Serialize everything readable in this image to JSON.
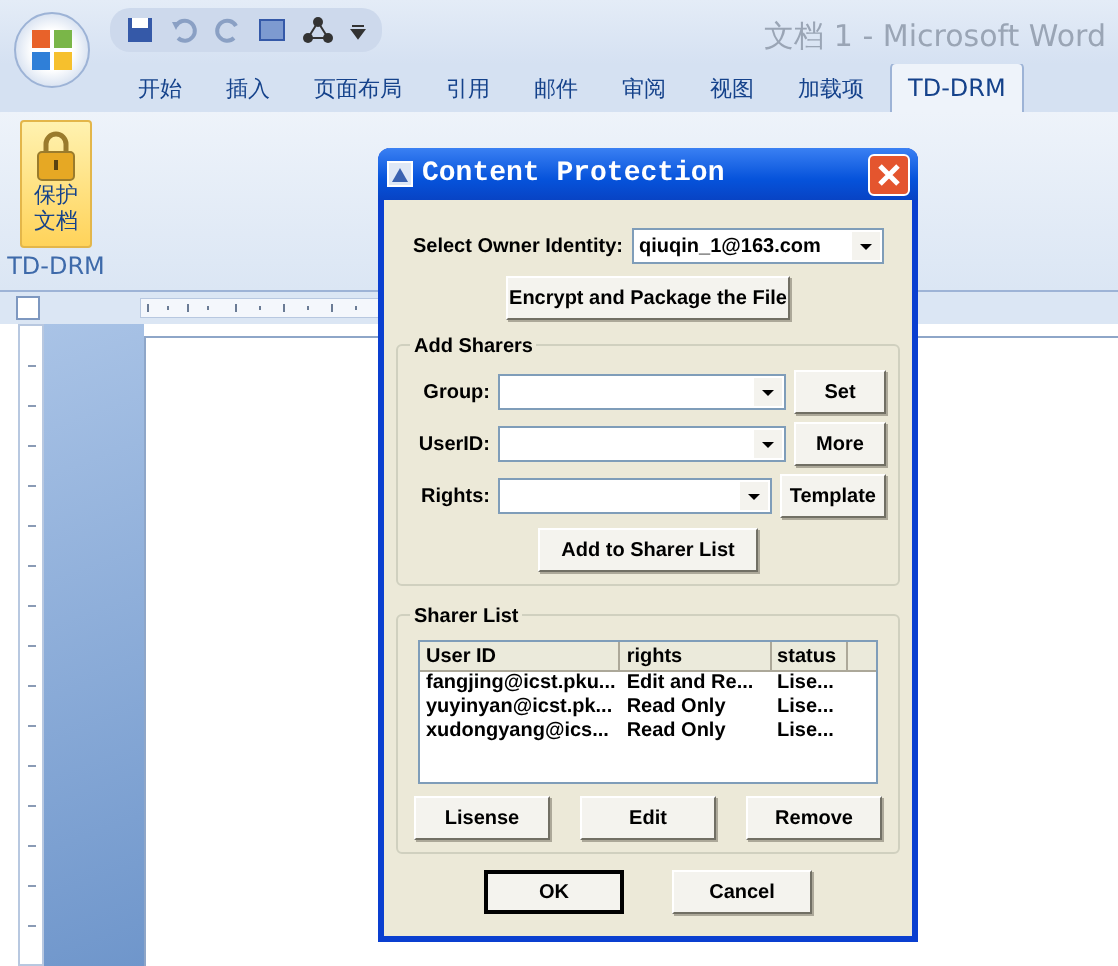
{
  "window": {
    "title": "文档 1 - Microsoft Word"
  },
  "ribbon_tabs": [
    {
      "label": "开始",
      "selected": false
    },
    {
      "label": "插入",
      "selected": false
    },
    {
      "label": "页面布局",
      "selected": false
    },
    {
      "label": "引用",
      "selected": false
    },
    {
      "label": "邮件",
      "selected": false
    },
    {
      "label": "审阅",
      "selected": false
    },
    {
      "label": "视图",
      "selected": false
    },
    {
      "label": "加载项",
      "selected": false
    },
    {
      "label": "TD-DRM",
      "selected": true
    }
  ],
  "ribbon": {
    "protect_button": [
      "保护",
      "文档"
    ],
    "group_label": "TD-DRM"
  },
  "dialog": {
    "title": "Content Protection",
    "owner_label": "Select Owner Identity:",
    "owner_value": "qiuqin_1@163.com",
    "encrypt_button": "Encrypt and Package the File",
    "add_sharers": {
      "title": "Add Sharers",
      "fields": [
        {
          "label": "Group:",
          "button": "Set"
        },
        {
          "label": "UserID:",
          "button": "More"
        },
        {
          "label": "Rights:",
          "button": "Template"
        }
      ],
      "add_button": "Add to Sharer List"
    },
    "sharer_list": {
      "title": "Sharer List",
      "columns": [
        "User ID",
        "rights",
        "status"
      ],
      "rows": [
        [
          "fangjing@icst.pku...",
          "Edit and Re...",
          "Lise..."
        ],
        [
          "yuyinyan@icst.pk...",
          "Read Only",
          "Lise..."
        ],
        [
          "xudongyang@ics...",
          "Read Only",
          "Lise..."
        ]
      ],
      "buttons": [
        "Lisense",
        "Edit",
        "Remove"
      ]
    },
    "buttons": [
      {
        "label": "OK",
        "default": true
      },
      {
        "label": "Cancel",
        "default": false
      }
    ]
  }
}
